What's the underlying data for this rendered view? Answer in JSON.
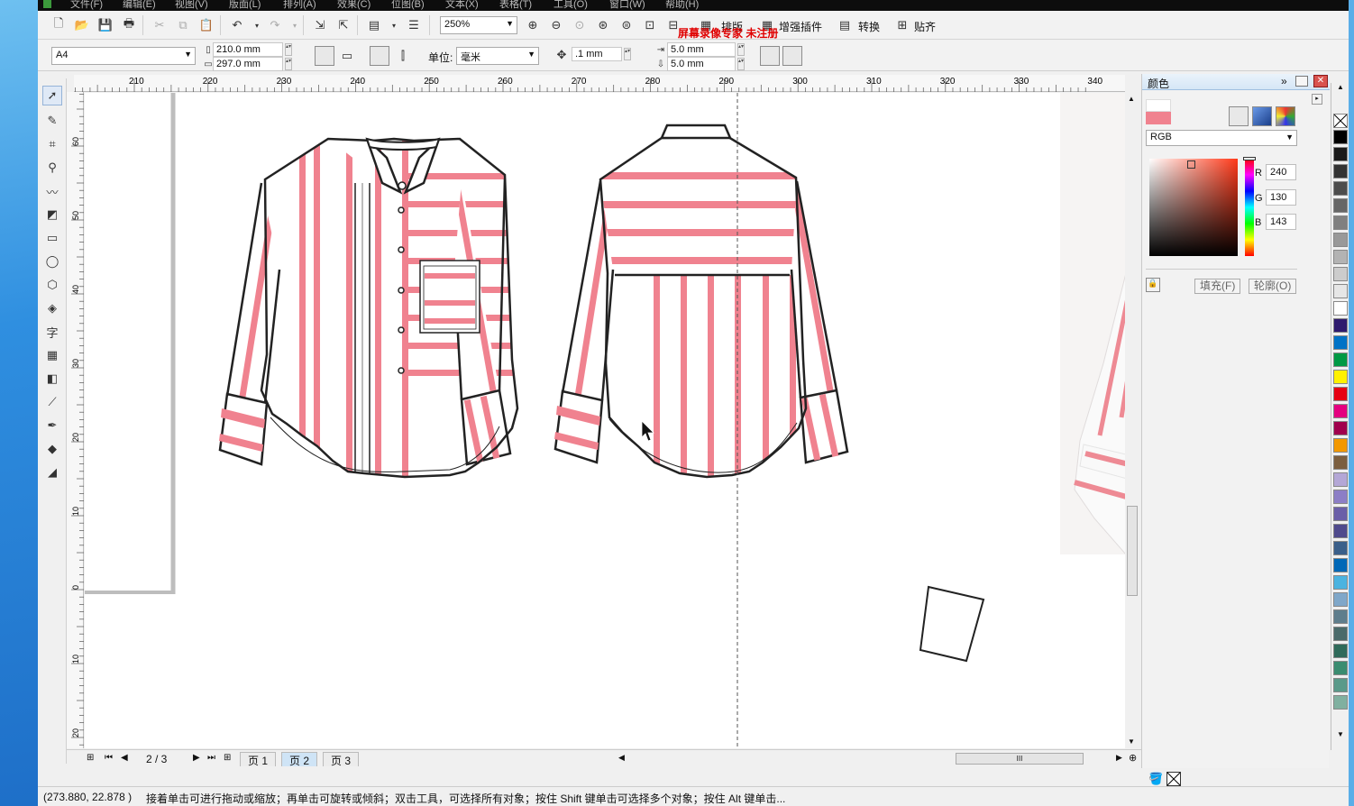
{
  "menu": [
    "文件(F)",
    "编辑(E)",
    "视图(V)",
    "版面(L)",
    "排列(A)",
    "效果(C)",
    "位图(B)",
    "文本(X)",
    "表格(T)",
    "工具(O)",
    "窗口(W)",
    "帮助(H)"
  ],
  "watermark": "屏幕录像专家 未注册",
  "toolbar": {
    "zoom": "250%",
    "plugins": [
      {
        "label": "排版"
      },
      {
        "label": "增强插件"
      },
      {
        "label": "转换"
      },
      {
        "label": "贴齐"
      }
    ]
  },
  "propbar": {
    "page_size": "A4",
    "width": "210.0 mm",
    "height": "297.0 mm",
    "unit_label": "单位:",
    "unit": "毫米",
    "nudge": ".1 mm",
    "dup_x": "5.0 mm",
    "dup_y": "5.0 mm"
  },
  "ruler_h": [
    "210",
    "220",
    "230",
    "240",
    "250",
    "260",
    "270",
    "280",
    "290",
    "300",
    "310",
    "320",
    "330",
    "340"
  ],
  "ruler_v": [
    "60",
    "50",
    "40",
    "30",
    "20",
    "10",
    "0",
    "10",
    "20"
  ],
  "page_nav": {
    "counter": "2 / 3",
    "tabs": [
      "页 1",
      "页 2",
      "页 3"
    ],
    "active": 1
  },
  "color_docker": {
    "title": "颜色",
    "model": "RGB",
    "r": "240",
    "g": "130",
    "b": "143",
    "r_label": "R",
    "g_label": "G",
    "b_label": "B",
    "fill_button": "填充(F)",
    "outline_button": "轮廓(O)",
    "current_color": "#f0828f"
  },
  "palette": [
    "#000000",
    "#1a1a1a",
    "#333333",
    "#4d4d4d",
    "#666666",
    "#808080",
    "#999999",
    "#b3b3b3",
    "#cccccc",
    "#e6e6e6",
    "#ffffff",
    "#2e1a6e",
    "#0072c6",
    "#009944",
    "#fff100",
    "#e60012",
    "#e4007f",
    "#a0004d",
    "#f39800",
    "#7b5e3f",
    "#b4a7d6",
    "#8c7ec6",
    "#6a5fa8",
    "#4f4a8c",
    "#3a5f8a",
    "#0068b7",
    "#4bb3e0",
    "#7fa7c9",
    "#5e7d8c",
    "#4a6a6a",
    "#2f6a5a",
    "#3a8c70",
    "#5a9a8a",
    "#80b0a0"
  ],
  "status": {
    "coords": "(273.880, 22.878 )",
    "hint": "接着单击可进行拖动或缩放；再单击可旋转或倾斜；双击工具，可选择所有对象；按住 Shift 键单击可选择多个对象；按住 Alt 键单击..."
  },
  "colors": {
    "stripe": "#f0828f",
    "outline": "#222222",
    "accent": "#3b82d6"
  }
}
